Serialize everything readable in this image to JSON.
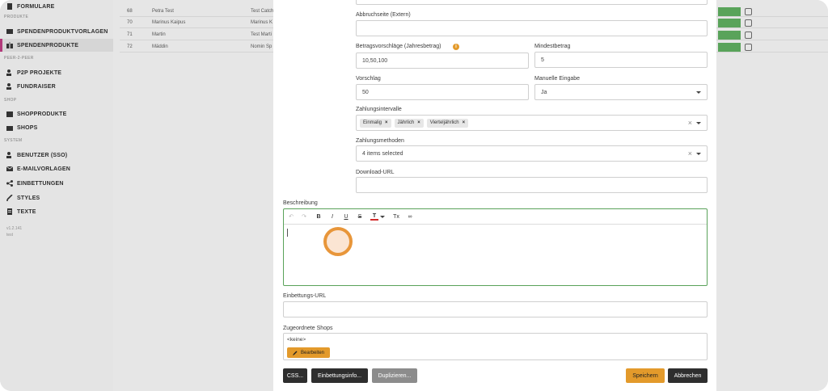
{
  "sidebar": {
    "items": [
      {
        "label": "FORMULARE",
        "icon": "document-icon"
      },
      {
        "label": "SPENDENPRODUKTVORLAGEN",
        "icon": "folder-icon"
      },
      {
        "label": "SPENDENPRODUKTE",
        "icon": "gift-icon"
      },
      {
        "label": "P2P PROJEKTE",
        "icon": "users-icon"
      },
      {
        "label": "FUNDRAISER",
        "icon": "users-icon"
      },
      {
        "label": "SHOPPRODUKTE",
        "icon": "box-icon"
      },
      {
        "label": "SHOPS",
        "icon": "shop-icon"
      },
      {
        "label": "BENUTZER (SSO)",
        "icon": "users-icon"
      },
      {
        "label": "E-MAILVORLAGEN",
        "icon": "mail-icon"
      },
      {
        "label": "EINBETTUNGEN",
        "icon": "share-icon"
      },
      {
        "label": "STYLES",
        "icon": "brush-icon"
      },
      {
        "label": "TEXTE",
        "icon": "text-icon"
      }
    ],
    "sections": [
      "PRODUKTE",
      "PEER-2-PEER",
      "SHOP",
      "SYSTEM"
    ],
    "version": "v1.2.141",
    "version_sub": "test"
  },
  "background_table": {
    "rows": [
      {
        "id": "68",
        "name": "Petra Test",
        "extra": "Test Catch"
      },
      {
        "id": "70",
        "name": "Marinus Kaipus",
        "extra": "Marinus K"
      },
      {
        "id": "71",
        "name": "Martin",
        "extra": "Test Marti"
      },
      {
        "id": "72",
        "name": "Mäddin",
        "extra": "Nomin Sp"
      }
    ]
  },
  "form": {
    "abbruchseite_label": "Abbruchseite (Extern)",
    "abbruchseite_value": "",
    "betragsvorschlaege_label": "Betragsvorschläge (Jahresbetrag)",
    "betragsvorschlaege_value": "10,50,100",
    "info_icon": "i",
    "mindestbetrag_label": "Mindestbetrag",
    "mindestbetrag_value": "5",
    "vorschlag_label": "Vorschlag",
    "vorschlag_value": "50",
    "manuelle_eingabe_label": "Manuelle Eingabe",
    "manuelle_eingabe_value": "Ja",
    "zahlungsintervalle_label": "Zahlungsintervalle",
    "zahlungsintervalle_chips": [
      "Einmalig",
      "Jährlich",
      "Vierteljährlich"
    ],
    "chip_remove": "×",
    "clear_symbol": "×",
    "zahlungsmethoden_label": "Zahlungsmethoden",
    "zahlungsmethoden_value": "4 items selected",
    "download_url_label": "Download-URL",
    "download_url_value": "",
    "beschreibung_label": "Beschreibung",
    "toolbar": [
      "↶",
      "↷",
      "B",
      "I",
      "U",
      "S",
      "T",
      "Tx",
      "∞"
    ],
    "einbettungs_url_label": "Einbettungs-URL",
    "einbettungs_url_value": "",
    "zugeordnete_shops_label": "Zugeordnete Shops",
    "shops_value": "<keine>",
    "bearbeiten_label": "Bearbeiten"
  },
  "footer": {
    "css_label": "CSS...",
    "einbettungsinfo_label": "Einbettungsinfo...",
    "duplizieren_label": "Duplizieren...",
    "speichern_label": "Speichern",
    "abbrechen_label": "Abbrechen"
  },
  "colors": {
    "accent_orange": "#e39a2b",
    "active_border": "#b23a7a",
    "editor_focus": "#5aa25a",
    "status_green": "#59a35a"
  }
}
